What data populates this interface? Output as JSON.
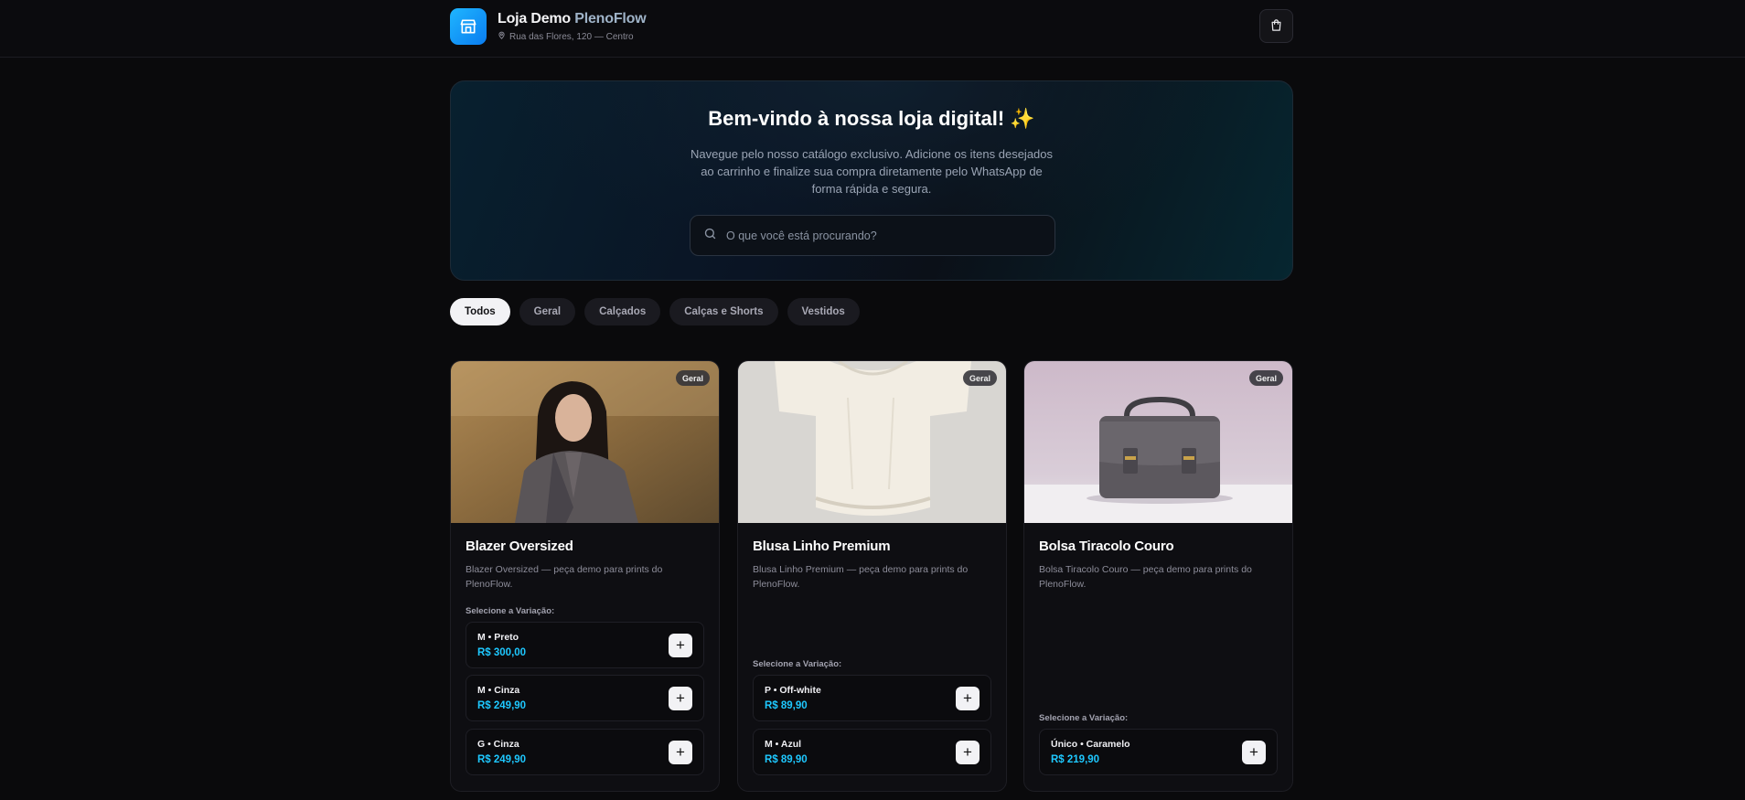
{
  "header": {
    "store_name": "Loja Demo",
    "store_accent": "PlenoFlow",
    "address": "Rua das Flores, 120 — Centro",
    "logo_icon": "storefront-icon",
    "cart_icon": "shopping-bag-icon"
  },
  "hero": {
    "title": "Bem-vindo à nossa loja digital!",
    "sparkle": "✨",
    "description": "Navegue pelo nosso catálogo exclusivo. Adicione os itens desejados ao carrinho e finalize sua compra diretamente pelo WhatsApp de forma rápida e segura.",
    "search_placeholder": "O que você está procurando?"
  },
  "filters": [
    "Todos",
    "Geral",
    "Calçados",
    "Calças e Shorts",
    "Vestidos"
  ],
  "active_filter": "Todos",
  "variation_label": "Selecione a Variação:",
  "products": [
    {
      "name": "Blazer Oversized",
      "category": "Geral",
      "description": "Blazer Oversized — peça demo para prints do PlenoFlow.",
      "variants": [
        {
          "name": "M • Preto",
          "price": "R$ 300,00"
        },
        {
          "name": "M • Cinza",
          "price": "R$ 249,90"
        },
        {
          "name": "G • Cinza",
          "price": "R$ 249,90"
        }
      ]
    },
    {
      "name": "Blusa Linho Premium",
      "category": "Geral",
      "description": "Blusa Linho Premium — peça demo para prints do PlenoFlow.",
      "variants": [
        {
          "name": "P • Off-white",
          "price": "R$ 89,90"
        },
        {
          "name": "M • Azul",
          "price": "R$ 89,90"
        }
      ]
    },
    {
      "name": "Bolsa Tiracolo Couro",
      "category": "Geral",
      "description": "Bolsa Tiracolo Couro — peça demo para prints do PlenoFlow.",
      "variants": [
        {
          "name": "Único • Caramelo",
          "price": "R$ 219,90"
        }
      ]
    }
  ],
  "colors": {
    "accent": "#1ec8ff",
    "logo": "#0a7cf0",
    "background": "#0a0a0c"
  }
}
